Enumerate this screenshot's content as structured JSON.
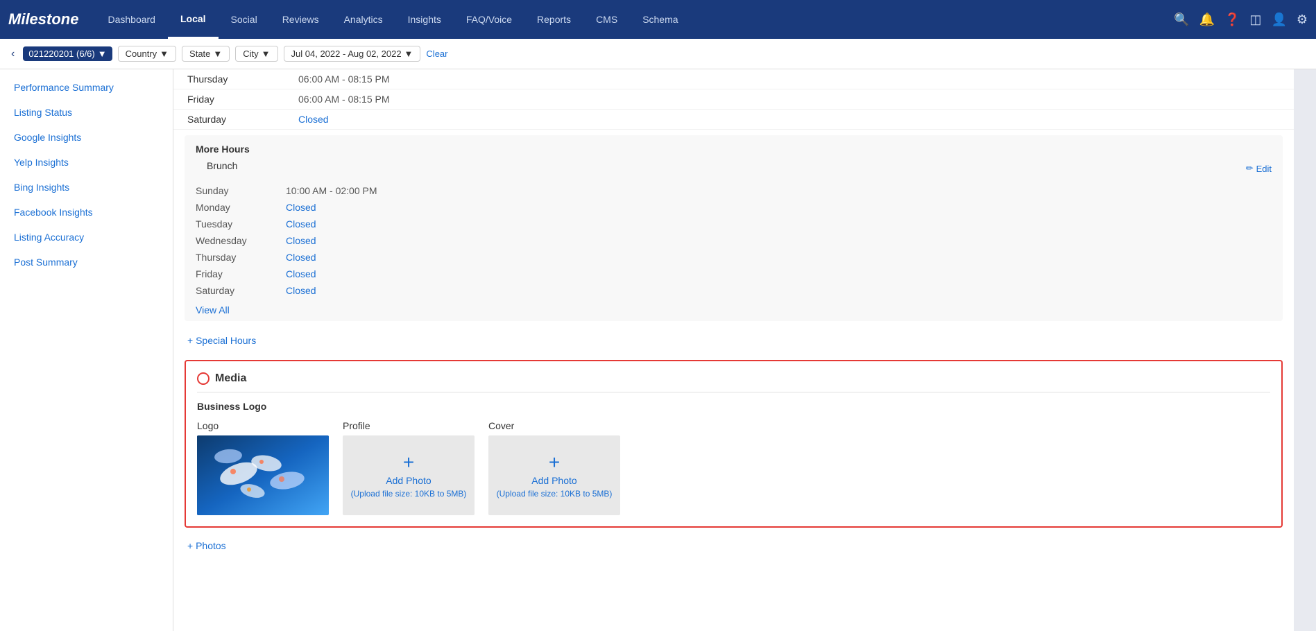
{
  "app": {
    "logo": "Milestone"
  },
  "nav": {
    "items": [
      {
        "label": "Dashboard",
        "active": false
      },
      {
        "label": "Local",
        "active": true
      },
      {
        "label": "Social",
        "active": false
      },
      {
        "label": "Reviews",
        "active": false
      },
      {
        "label": "Analytics",
        "active": false
      },
      {
        "label": "Insights",
        "active": false
      },
      {
        "label": "FAQ/Voice",
        "active": false
      },
      {
        "label": "Reports",
        "active": false
      },
      {
        "label": "CMS",
        "active": false
      },
      {
        "label": "Schema",
        "active": false
      }
    ],
    "icons": [
      "search",
      "bell",
      "question",
      "grid",
      "user",
      "gear"
    ]
  },
  "subheader": {
    "badge": "021220201 (6/6)",
    "country_filter": "Country",
    "state_filter": "State",
    "city_filter": "City",
    "date_range": "Jul 04, 2022 - Aug 02, 2022",
    "clear_label": "Clear"
  },
  "sidebar": {
    "items": [
      {
        "label": "Performance Summary"
      },
      {
        "label": "Listing Status"
      },
      {
        "label": "Google Insights"
      },
      {
        "label": "Yelp Insights"
      },
      {
        "label": "Bing Insights"
      },
      {
        "label": "Facebook Insights"
      },
      {
        "label": "Listing Accuracy"
      },
      {
        "label": "Post Summary"
      }
    ]
  },
  "hours": {
    "regular": [
      {
        "day": "Thursday",
        "time": "06:00 AM - 08:15 PM"
      },
      {
        "day": "Friday",
        "time": "06:00 AM - 08:15 PM"
      },
      {
        "day": "Saturday",
        "time": "Closed",
        "closed": true
      }
    ],
    "more_hours_title": "More Hours",
    "brunch_label": "Brunch",
    "edit_label": "Edit",
    "brunch_rows": [
      {
        "day": "Sunday",
        "time": "10:00 AM - 02:00 PM",
        "closed": false
      },
      {
        "day": "Monday",
        "time": "Closed",
        "closed": true
      },
      {
        "day": "Tuesday",
        "time": "Closed",
        "closed": true
      },
      {
        "day": "Wednesday",
        "time": "Closed",
        "closed": true
      },
      {
        "day": "Thursday",
        "time": "Closed",
        "closed": true
      },
      {
        "day": "Friday",
        "time": "Closed",
        "closed": true
      },
      {
        "day": "Saturday",
        "time": "Closed",
        "closed": true
      }
    ],
    "view_all_label": "View All",
    "special_hours_label": "+ Special Hours"
  },
  "media": {
    "title": "Media",
    "business_logo_label": "Business Logo",
    "cards": [
      {
        "label": "Logo",
        "type": "image"
      },
      {
        "label": "Profile",
        "type": "placeholder",
        "add_text": "Add Photo",
        "upload_note": "(Upload file size: 10KB to 5MB)"
      },
      {
        "label": "Cover",
        "type": "placeholder",
        "add_text": "Add Photo",
        "upload_note": "(Upload file size: 10KB to 5MB)"
      }
    ],
    "photos_label": "+ Photos"
  }
}
